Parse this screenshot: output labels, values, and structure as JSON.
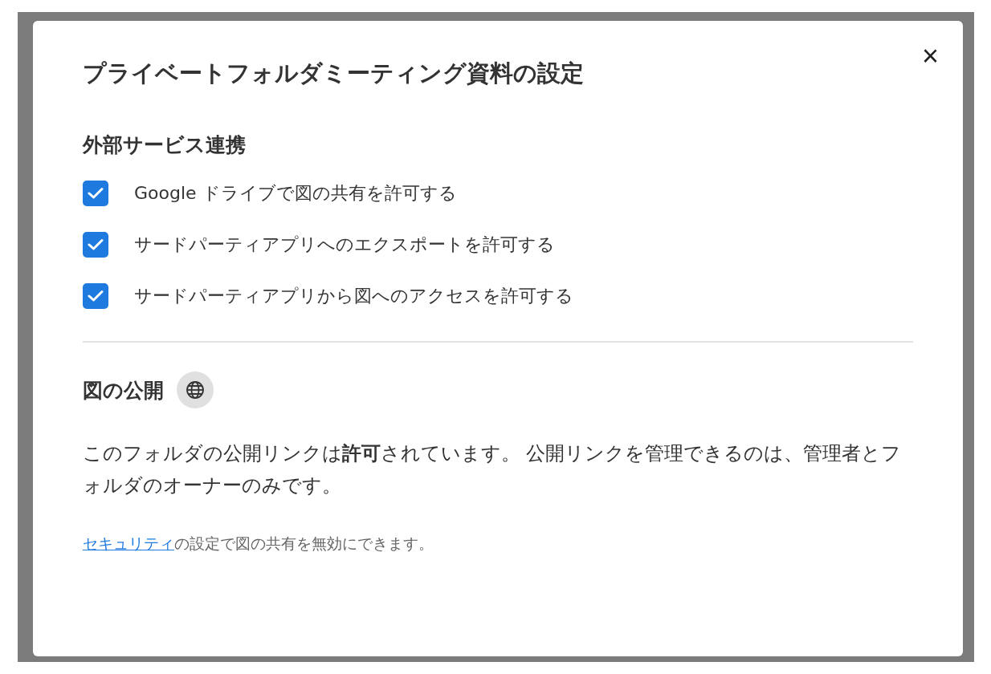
{
  "dialog": {
    "title": "プライベートフォルダミーティング資料の設定",
    "close": "×"
  },
  "integrations": {
    "heading": "外部サービス連携",
    "options": [
      {
        "label": "Google ドライブで図の共有を許可する",
        "checked": true
      },
      {
        "label": "サードパーティアプリへのエクスポートを許可する",
        "checked": true
      },
      {
        "label": "サードパーティアプリから図へのアクセスを許可する",
        "checked": true
      }
    ]
  },
  "publishing": {
    "heading": "図の公開",
    "description": "このフォルダの公開リンクは**許可**されています。 公開リンクを管理できるのは、管理者とフォルダのオーナーのみです。",
    "note_link": "セキュリティ",
    "note_text": "の設定で図の共有を無効にできます。"
  }
}
